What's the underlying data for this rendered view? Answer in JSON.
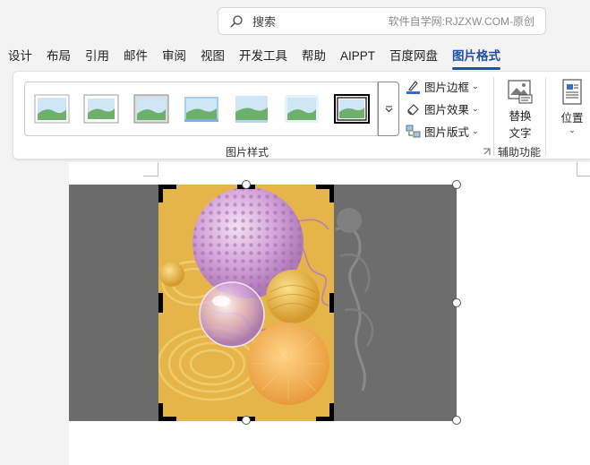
{
  "search": {
    "placeholder": "搜索",
    "watermark": "软件自学网:RJZXW.COM-原创"
  },
  "tabs": [
    "设计",
    "布局",
    "引用",
    "邮件",
    "审阅",
    "视图",
    "开发工具",
    "帮助",
    "AIPPT",
    "百度网盘",
    "图片格式"
  ],
  "active_tab": "图片格式",
  "ribbon": {
    "picture_styles_label": "图片样式",
    "border_label": "图片边框",
    "effects_label": "图片效果",
    "layout_label": "图片版式",
    "alt_text_label_1": "替换",
    "alt_text_label_2": "文字",
    "accessibility_label": "辅助功能",
    "position_label": "位置"
  },
  "colors": {
    "accent": "#1f4fa8",
    "crop_area": "#6b6b6b",
    "photo_bg": "#e6b54a"
  }
}
